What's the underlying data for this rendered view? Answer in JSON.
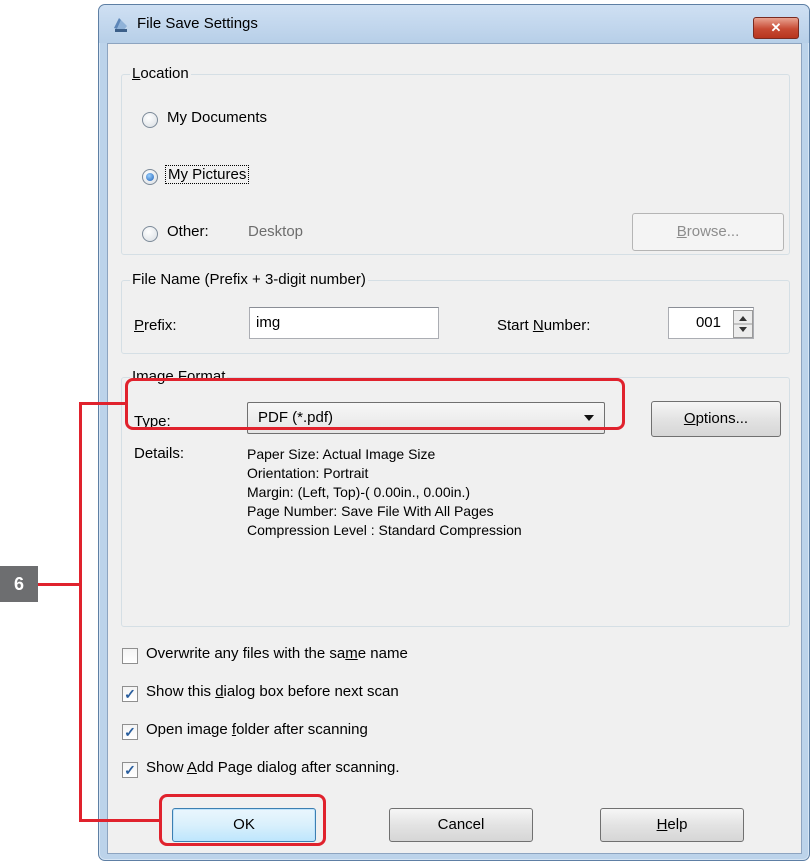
{
  "window": {
    "title": "File Save Settings",
    "close_label": "✕"
  },
  "location": {
    "legend_pre": "",
    "legend_u": "L",
    "legend_post": "ocation",
    "my_documents": "My Documents",
    "my_pictures": "My Pictures",
    "other": "Other:",
    "other_path": "Desktop",
    "browse_pre": "",
    "browse_u": "B",
    "browse_post": "rowse..."
  },
  "file_name": {
    "legend": "File Name (Prefix + 3-digit number)",
    "prefix_pre": "",
    "prefix_u": "P",
    "prefix_post": "refix:",
    "prefix_value": "img",
    "start_pre": "Start ",
    "start_u": "N",
    "start_post": "umber:",
    "start_value": "001"
  },
  "image_format": {
    "legend": "Image Format",
    "type_pre": "",
    "type_u": "T",
    "type_post": "ype:",
    "type_value": "PDF (*.pdf)",
    "options_pre": "",
    "options_u": "O",
    "options_post": "ptions...",
    "details_label": "Details:",
    "details": [
      "Paper Size: Actual Image Size",
      "Orientation: Portrait",
      "Margin: (Left, Top)-( 0.00in., 0.00in.)",
      "Page Number: Save File With All Pages",
      "Compression Level : Standard Compression"
    ]
  },
  "checkboxes": [
    {
      "pre": "Overwrite any files with the sa",
      "u": "m",
      "post": "e name",
      "checked": false
    },
    {
      "pre": "Show this ",
      "u": "d",
      "post": "ialog box before next scan",
      "checked": true
    },
    {
      "pre": "Open image ",
      "u": "f",
      "post": "older after scanning",
      "checked": true
    },
    {
      "pre": "Show ",
      "u": "A",
      "post": "dd Page dialog after scanning.",
      "checked": true
    }
  ],
  "buttons": {
    "ok": "OK",
    "cancel": "Cancel",
    "help_pre": "",
    "help_u": "H",
    "help_post": "elp"
  },
  "callout": {
    "step": "6",
    "color": "#e0222d"
  },
  "colors": {
    "frame": "#bcd3ea",
    "client": "#f0f0f0",
    "highlight": "#e0222d"
  }
}
